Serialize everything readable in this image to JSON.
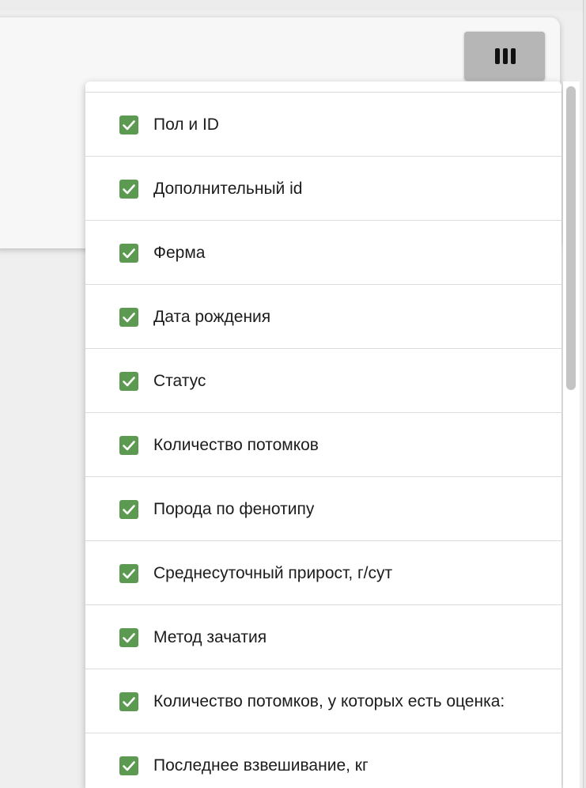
{
  "toolbar": {
    "columns_button_icon": "view-columns-icon"
  },
  "menu": {
    "items": [
      {
        "label": "Пол и ID",
        "checked": true
      },
      {
        "label": "Дополнительный id",
        "checked": true
      },
      {
        "label": "Ферма",
        "checked": true
      },
      {
        "label": "Дата рождения",
        "checked": true
      },
      {
        "label": "Статус",
        "checked": true
      },
      {
        "label": "Количество потомков",
        "checked": true
      },
      {
        "label": "Порода по фенотипу",
        "checked": true
      },
      {
        "label": "Среднесуточный прирост, г/сут",
        "checked": true
      },
      {
        "label": "Метод зачатия",
        "checked": true
      },
      {
        "label": "Количество потомков, у которых есть оценка:",
        "checked": true
      },
      {
        "label": "Последнее взвешивание, кг",
        "checked": true
      }
    ]
  },
  "colors": {
    "checkbox": "#5b9a50",
    "button": "#b6b6b6"
  }
}
